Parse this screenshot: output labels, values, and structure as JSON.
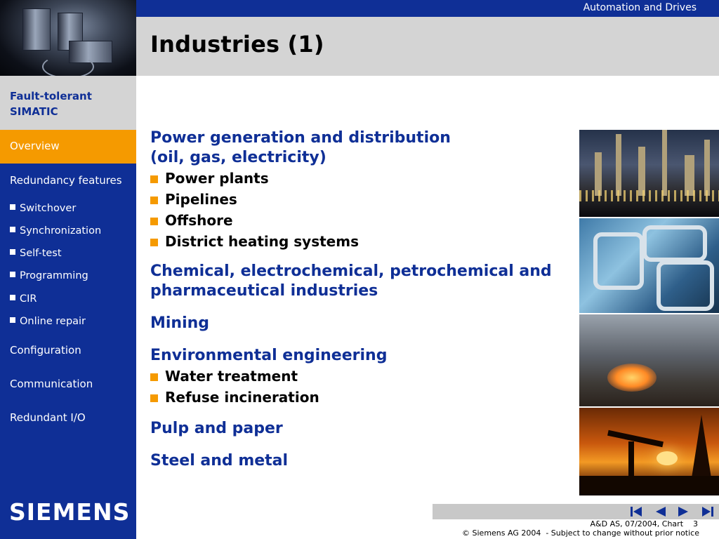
{
  "header": {
    "brand_tag": "Automation and Drives",
    "title": "Industries (1)"
  },
  "sidebar": {
    "product_title": "Fault-tolerant SIMATIC",
    "items": [
      {
        "label": "Overview",
        "active": true
      },
      {
        "label": "Redundancy features"
      },
      {
        "label": "Switchover"
      },
      {
        "label": "Synchronization"
      },
      {
        "label": "Self-test"
      },
      {
        "label": "Programming"
      },
      {
        "label": "CIR"
      },
      {
        "label": "Online repair"
      },
      {
        "label": "Configuration"
      },
      {
        "label": "Communication"
      },
      {
        "label": "Redundant I/O"
      }
    ],
    "logo_text": "SIEMENS"
  },
  "content": {
    "sections": [
      {
        "heading_line1": "Power generation and distribution",
        "heading_line2": "(oil, gas, electricity)",
        "bullets": [
          "Power plants",
          "Pipelines",
          "Offshore",
          "District heating systems"
        ]
      },
      {
        "heading_line1": "Chemical, electrochemical, petrochemical and",
        "heading_line2": "pharmaceutical industries"
      },
      {
        "heading_line1": "Mining"
      },
      {
        "heading_line1": "Environmental engineering",
        "bullets": [
          "Water treatment",
          "Refuse incineration"
        ]
      },
      {
        "heading_line1": "Pulp and paper"
      },
      {
        "heading_line1": "Steel and metal"
      }
    ]
  },
  "photos": [
    "refinery-photo",
    "pipes-photo",
    "steelworks-photo",
    "oil-pump-photo"
  ],
  "footer": {
    "line1": "A&D AS, 07/2004, Chart    3",
    "line2": "© Siemens AG 2004  - Subject to change without prior notice"
  },
  "nav_buttons": [
    "first-slide-icon",
    "previous-slide-icon",
    "next-slide-icon",
    "last-slide-icon"
  ],
  "colors": {
    "brand_blue": "#0f2f96",
    "accent_orange": "#f59a00",
    "grey_band": "#d4d4d4"
  }
}
